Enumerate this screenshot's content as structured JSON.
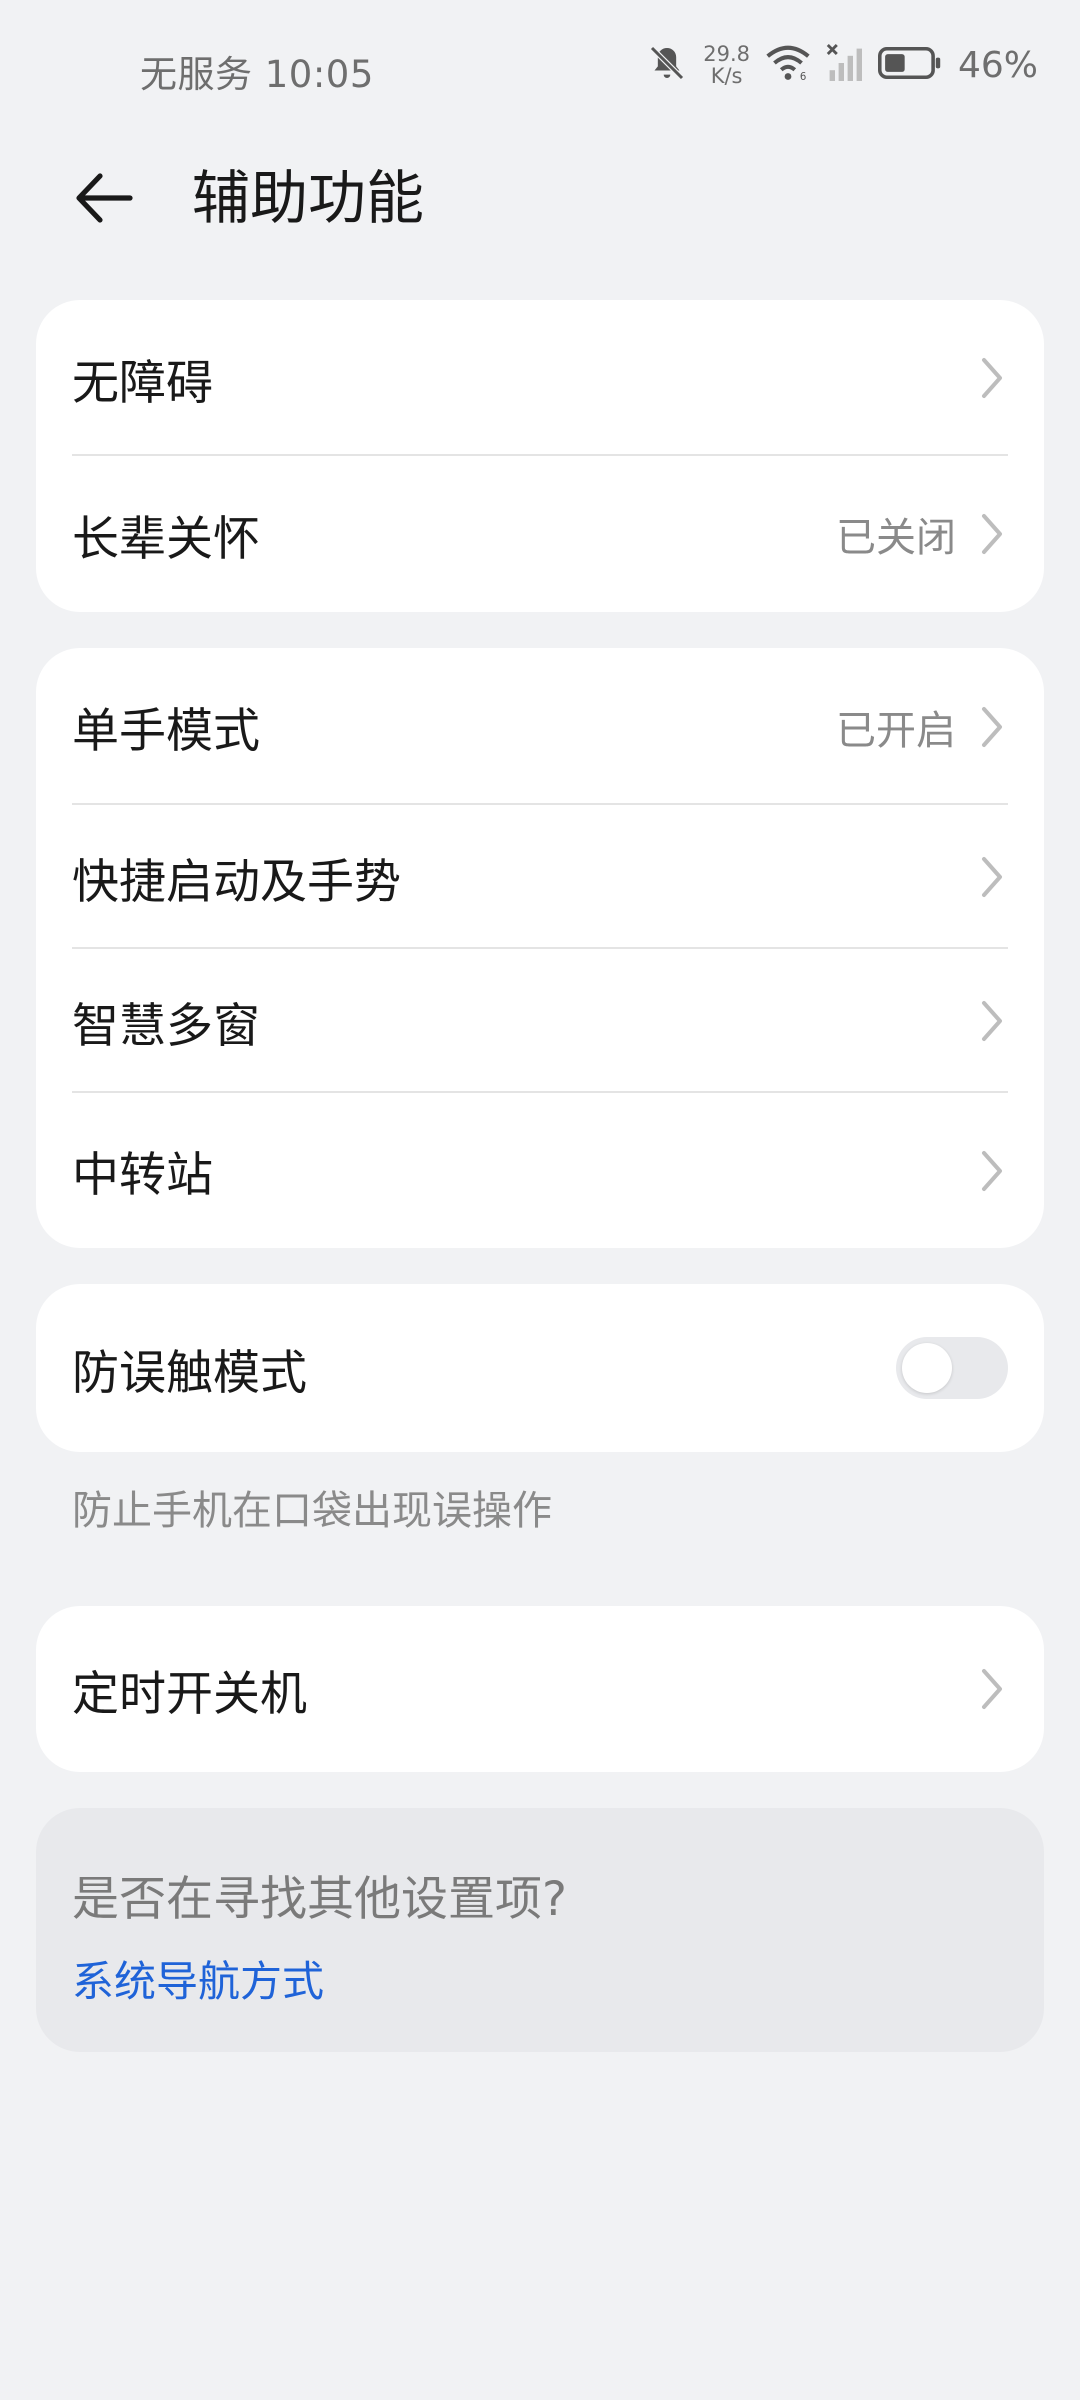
{
  "status": {
    "carrier_time": "无服务 10:05",
    "net_speed_value": "29.8",
    "net_speed_unit": "K/s",
    "battery_percent": "46%",
    "icons": [
      "bell-mute-icon",
      "wifi-icon",
      "signal-icon",
      "battery-icon"
    ],
    "battery_level": 0.46
  },
  "header": {
    "title": "辅助功能"
  },
  "group1": {
    "items": [
      {
        "label": "无障碍",
        "value": ""
      },
      {
        "label": "长辈关怀",
        "value": "已关闭"
      }
    ]
  },
  "group2": {
    "items": [
      {
        "label": "单手模式",
        "value": "已开启"
      },
      {
        "label": "快捷启动及手势",
        "value": ""
      },
      {
        "label": "智慧多窗",
        "value": ""
      },
      {
        "label": "中转站",
        "value": ""
      }
    ]
  },
  "group3": {
    "label": "防误触模式",
    "toggle_on": false,
    "helper": "防止手机在口袋出现误操作"
  },
  "group4": {
    "label": "定时开关机"
  },
  "suggest": {
    "title": "是否在寻找其他设置项?",
    "link": "系统导航方式"
  },
  "colors": {
    "background": "#F1F2F4",
    "card": "#FFFFFF",
    "link": "#1F63D8",
    "secondary_text": "#8A8A8A"
  }
}
